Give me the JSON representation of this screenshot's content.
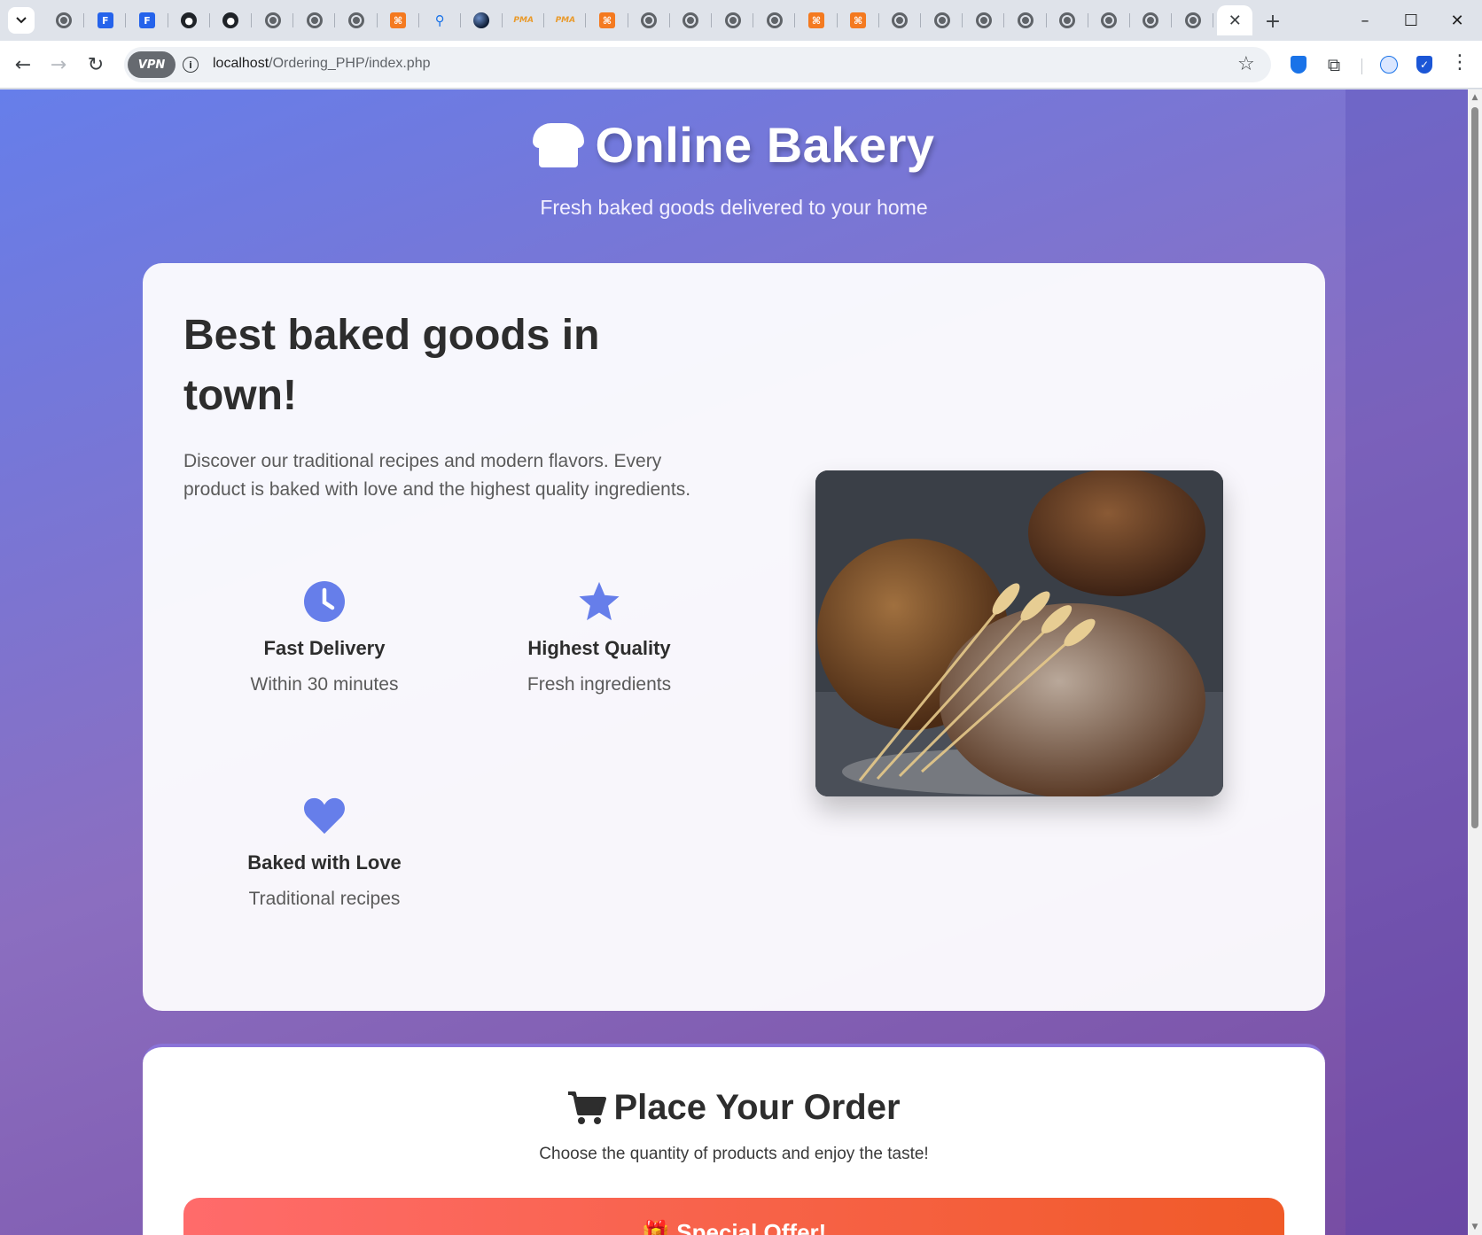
{
  "browser": {
    "tabs": [
      "globe",
      "form",
      "form",
      "github",
      "github",
      "globe",
      "globe",
      "globe",
      "xampp",
      "search",
      "earth",
      "pma",
      "pma",
      "xampp",
      "globe",
      "globe",
      "globe",
      "globe",
      "xampp",
      "xampp",
      "globe",
      "globe",
      "globe",
      "globe",
      "globe",
      "globe",
      "globe",
      "globe"
    ],
    "vpn_label": "VPN",
    "url_host": "localhost",
    "url_path": "/Ordering_PHP/index.php",
    "window_controls": {
      "minimize": "–",
      "maximize": "☐",
      "close": "✕"
    }
  },
  "header": {
    "title": "Online Bakery",
    "tagline": "Fresh baked goods delivered to your home",
    "icon": "bread-icon"
  },
  "hero": {
    "title": "Best baked goods in town!",
    "text": "Discover our traditional recipes and modern flavors. Every product is baked with love and the highest quality ingredients.",
    "features": [
      {
        "icon": "clock-icon",
        "title": "Fast Delivery",
        "subtitle": "Within 30 minutes"
      },
      {
        "icon": "star-icon",
        "title": "Highest Quality",
        "subtitle": "Fresh ingredients"
      },
      {
        "icon": "heart-icon",
        "title": "Baked with Love",
        "subtitle": "Traditional recipes"
      }
    ],
    "image": "bread-photo"
  },
  "order": {
    "title": "Place Your Order",
    "subtitle": "Choose the quantity of products and enjoy the taste!",
    "offer_label": "Special Offer!"
  },
  "colors": {
    "accent": "#667eea",
    "gradient_end": "#764ba2",
    "offer_start": "#ff6b6b",
    "offer_end": "#f05a28"
  }
}
